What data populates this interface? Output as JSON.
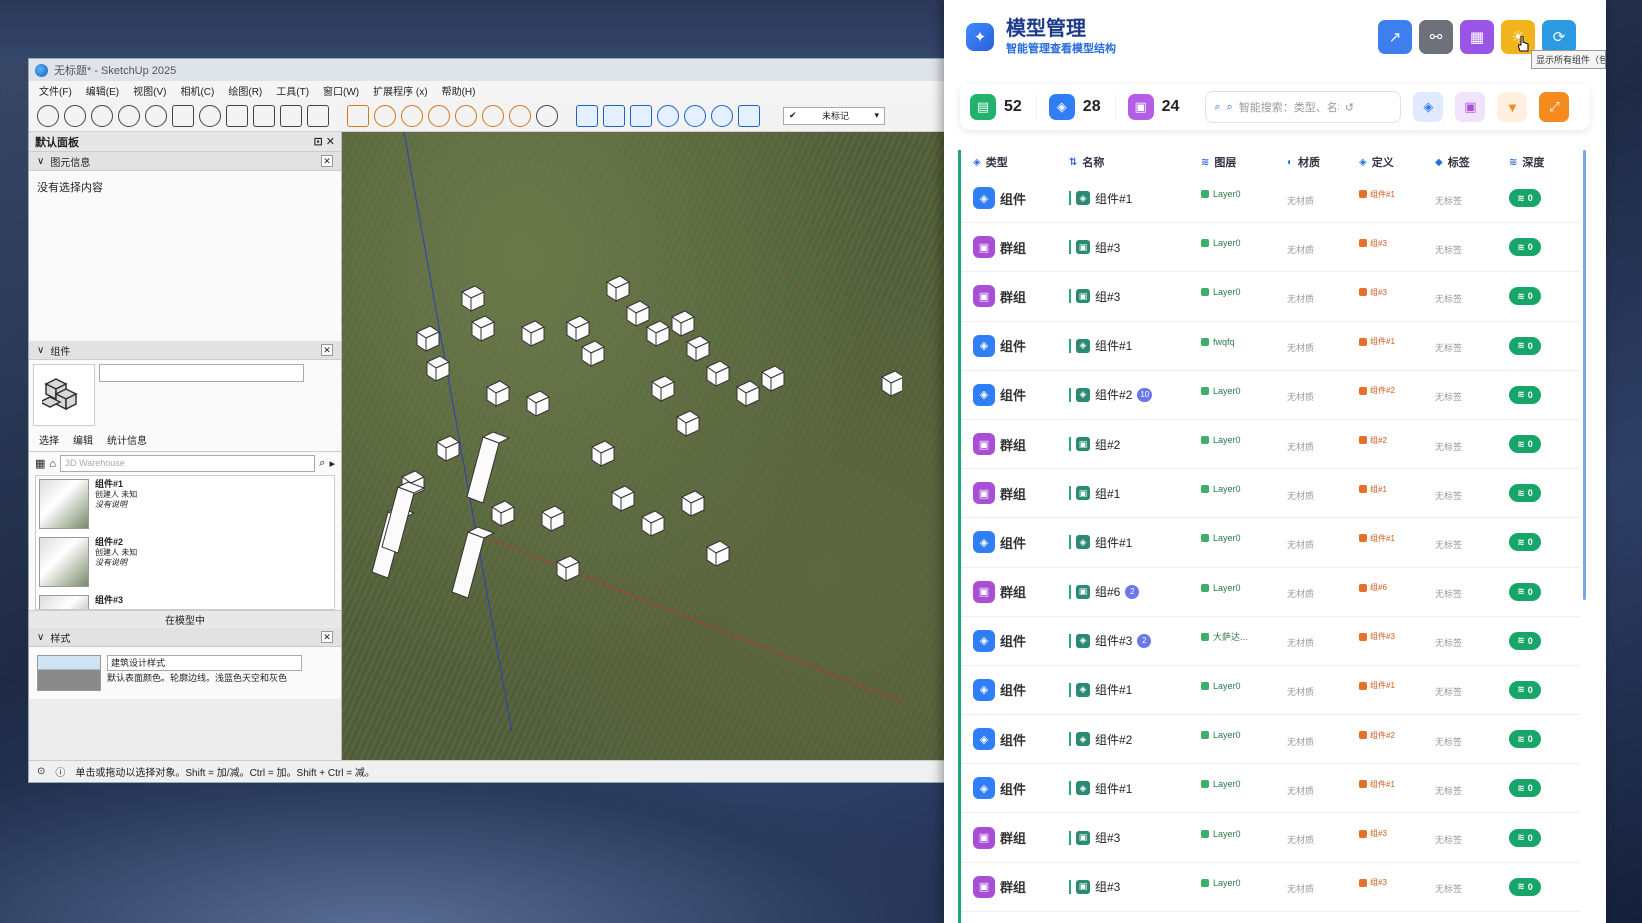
{
  "sketchup": {
    "title": "无标题* - SketchUp 2025",
    "menu": [
      "文件(F)",
      "编辑(E)",
      "视图(V)",
      "相机(C)",
      "绘图(R)",
      "工具(T)",
      "窗口(W)",
      "扩展程序 (x)",
      "帮助(H)"
    ],
    "tag_select": "未标记",
    "tray_title": "默认面板",
    "entity_panel": {
      "title": "图元信息",
      "empty": "没有选择内容"
    },
    "components_panel": {
      "title": "组件",
      "tabs": [
        "选择",
        "编辑",
        "统计信息"
      ],
      "search_placeholder": "3D Warehouse",
      "items": [
        {
          "name": "组件#1",
          "creator": "创建人 未知",
          "desc": "没有说明"
        },
        {
          "name": "组件#2",
          "creator": "创建人 未知",
          "desc": "没有说明"
        },
        {
          "name": "组件#3"
        }
      ],
      "in_model": "在模型中"
    },
    "styles_panel": {
      "title": "样式",
      "name": "建筑设计样式",
      "desc": "默认表面颜色。轮廓边线。浅蓝色天空和灰色"
    },
    "status": "单击或拖动以选择对象。Shift = 加/减。Ctrl = 加。Shift + Ctrl = 减。"
  },
  "manager": {
    "title": "模型管理",
    "subtitle": "智能管理查看模型结构",
    "tooltip": "显示所有组件（包括灯光）",
    "stats": {
      "total": "52",
      "components": "28",
      "groups": "24"
    },
    "search_placeholder": "智能搜索：类型、名称",
    "columns": [
      "类型",
      "名称",
      "图层",
      "材质",
      "定义",
      "标签",
      "深度"
    ],
    "rows": [
      {
        "type": "组件",
        "kind": "comp",
        "name": "组件#1",
        "count": "",
        "layer": "Layer0",
        "material": "无材质",
        "def": "组件#1",
        "tag": "无标签",
        "depth": "0"
      },
      {
        "type": "群组",
        "kind": "group",
        "name": "组#3",
        "count": "",
        "layer": "Layer0",
        "material": "无材质",
        "def": "组#3",
        "tag": "无标签",
        "depth": "0"
      },
      {
        "type": "群组",
        "kind": "group",
        "name": "组#3",
        "count": "",
        "layer": "Layer0",
        "material": "无材质",
        "def": "组#3",
        "tag": "无标签",
        "depth": "0"
      },
      {
        "type": "组件",
        "kind": "comp",
        "name": "组件#1",
        "count": "",
        "layer": "fwqfq",
        "material": "无材质",
        "def": "组件#1",
        "tag": "无标签",
        "depth": "0"
      },
      {
        "type": "组件",
        "kind": "comp",
        "name": "组件#2",
        "count": "10",
        "layer": "Layer0",
        "material": "无材质",
        "def": "组件#2",
        "tag": "无标签",
        "depth": "0"
      },
      {
        "type": "群组",
        "kind": "group",
        "name": "组#2",
        "count": "",
        "layer": "Layer0",
        "material": "无材质",
        "def": "组#2",
        "tag": "无标签",
        "depth": "0"
      },
      {
        "type": "群组",
        "kind": "group",
        "name": "组#1",
        "count": "",
        "layer": "Layer0",
        "material": "无材质",
        "def": "组#1",
        "tag": "无标签",
        "depth": "0"
      },
      {
        "type": "组件",
        "kind": "comp",
        "name": "组件#1",
        "count": "",
        "layer": "Layer0",
        "material": "无材质",
        "def": "组件#1",
        "tag": "无标签",
        "depth": "0"
      },
      {
        "type": "群组",
        "kind": "group",
        "name": "组#6",
        "count": "2",
        "layer": "Layer0",
        "material": "无材质",
        "def": "组#6",
        "tag": "无标签",
        "depth": "0"
      },
      {
        "type": "组件",
        "kind": "comp",
        "name": "组件#3",
        "count": "2",
        "layer": "大萨达...",
        "material": "无材质",
        "def": "组件#3",
        "tag": "无标签",
        "depth": "0"
      },
      {
        "type": "组件",
        "kind": "comp",
        "name": "组件#1",
        "count": "",
        "layer": "Layer0",
        "material": "无材质",
        "def": "组件#1",
        "tag": "无标签",
        "depth": "0"
      },
      {
        "type": "组件",
        "kind": "comp",
        "name": "组件#2",
        "count": "",
        "layer": "Layer0",
        "material": "无材质",
        "def": "组件#2",
        "tag": "无标签",
        "depth": "0"
      },
      {
        "type": "组件",
        "kind": "comp",
        "name": "组件#1",
        "count": "",
        "layer": "Layer0",
        "material": "无材质",
        "def": "组件#1",
        "tag": "无标签",
        "depth": "0"
      },
      {
        "type": "群组",
        "kind": "group",
        "name": "组#3",
        "count": "",
        "layer": "Layer0",
        "material": "无材质",
        "def": "组#3",
        "tag": "无标签",
        "depth": "0"
      },
      {
        "type": "群组",
        "kind": "group",
        "name": "组#3",
        "count": "",
        "layer": "Layer0",
        "material": "无材质",
        "def": "组#3",
        "tag": "无标签",
        "depth": "0"
      }
    ],
    "colors": {
      "accent": "#2a6ddc",
      "component": "#2f7ef5",
      "group": "#a84fd6",
      "depth": "#17a56a",
      "green_border": "#23a37a"
    }
  }
}
